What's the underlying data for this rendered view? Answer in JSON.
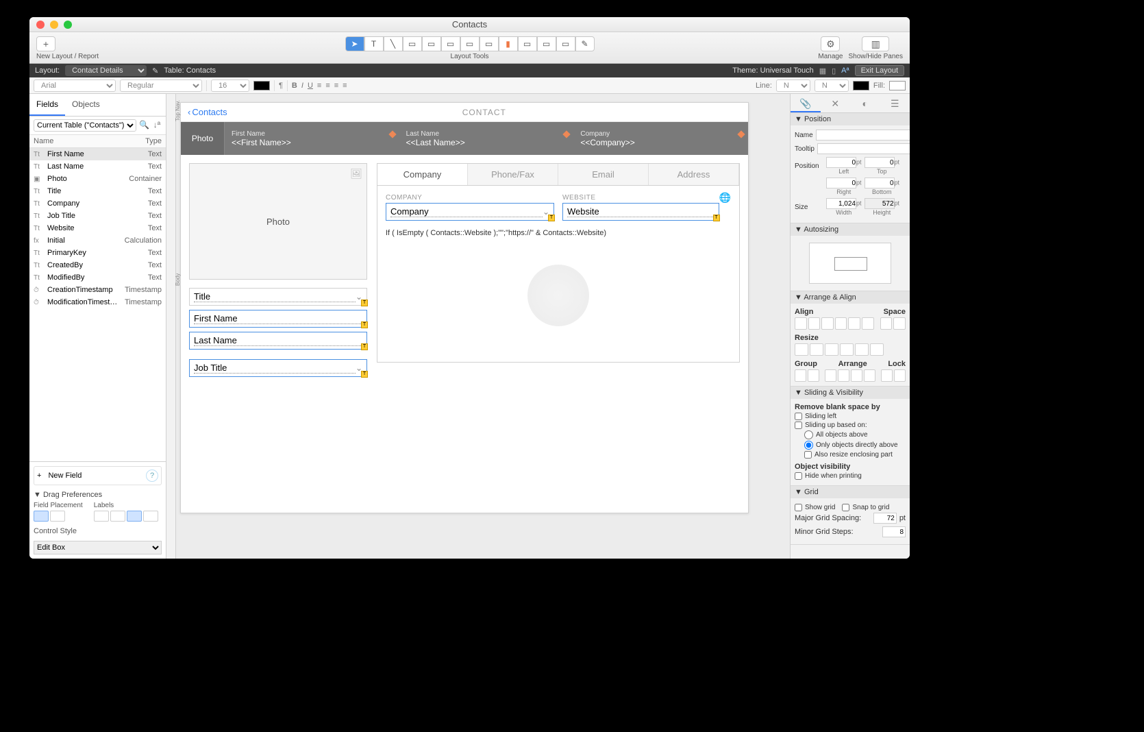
{
  "window": {
    "title": "Contacts"
  },
  "toolbar": {
    "newLayout": "New Layout / Report",
    "layoutTools": "Layout Tools",
    "manage": "Manage",
    "showHide": "Show/Hide Panes"
  },
  "statusbar": {
    "layoutLabel": "Layout:",
    "layoutName": "Contact Details",
    "tableLabel": "Table: Contacts",
    "themeLabel": "Theme: Universal Touch",
    "exit": "Exit Layout"
  },
  "formatbar": {
    "font": "Arial",
    "weight": "Regular",
    "size": "16 pt",
    "lineLabel": "Line:",
    "lineStyle": "None",
    "lineWidth": "None",
    "fillLabel": "Fill:"
  },
  "leftPanel": {
    "tabFields": "Fields",
    "tabObjects": "Objects",
    "currentTable": "Current Table (\"Contacts\")",
    "colName": "Name",
    "colType": "Type",
    "fields": [
      {
        "icon": "Tt",
        "name": "First Name",
        "type": "Text",
        "sel": true
      },
      {
        "icon": "Tt",
        "name": "Last Name",
        "type": "Text"
      },
      {
        "icon": "▣",
        "name": "Photo",
        "type": "Container"
      },
      {
        "icon": "Tt",
        "name": "Title",
        "type": "Text"
      },
      {
        "icon": "Tt",
        "name": "Company",
        "type": "Text"
      },
      {
        "icon": "Tt",
        "name": "Job Title",
        "type": "Text"
      },
      {
        "icon": "Tt",
        "name": "Website",
        "type": "Text"
      },
      {
        "icon": "fx",
        "name": "Initial",
        "type": "Calculation"
      },
      {
        "icon": "Tt",
        "name": "PrimaryKey",
        "type": "Text"
      },
      {
        "icon": "Tt",
        "name": "CreatedBy",
        "type": "Text"
      },
      {
        "icon": "Tt",
        "name": "ModifiedBy",
        "type": "Text"
      },
      {
        "icon": "⏱",
        "name": "CreationTimestamp",
        "type": "Timestamp"
      },
      {
        "icon": "⏱",
        "name": "ModificationTimesta…",
        "type": "Timestamp"
      }
    ],
    "newField": "New Field",
    "dragPrefs": "Drag Preferences",
    "fieldPlacement": "Field Placement",
    "labels": "Labels",
    "controlStyle": "Control Style",
    "controlValue": "Edit Box"
  },
  "canvas": {
    "partTop": "Top Nav.",
    "partBody": "Body",
    "back": "Contacts",
    "pageTitle": "CONTACT",
    "photoCell": "Photo",
    "h1l": "First Name",
    "h1m": "<<First Name>>",
    "h2l": "Last Name",
    "h2m": "<<Last Name>>",
    "h3l": "Company",
    "h3m": "<<Company>>",
    "photoBox": "Photo",
    "fTitle": "Title",
    "fFirst": "First Name",
    "fLast": "Last Name",
    "fJob": "Job Title",
    "tabs": [
      "Company",
      "Phone/Fax",
      "Email",
      "Address"
    ],
    "lblCompany": "COMPANY",
    "lblWebsite": "WEBSITE",
    "fCompany": "Company",
    "fWebsite": "Website",
    "calc": "If ( IsEmpty ( Contacts::Website );\"\";\"https://\" & Contacts::Website)"
  },
  "inspector": {
    "secPosition": "Position",
    "name": "Name",
    "tooltip": "Tooltip",
    "position": "Position",
    "left": "Left",
    "top": "Top",
    "right": "Right",
    "bottom": "Bottom",
    "posLeft": "0",
    "posTop": "0",
    "posRight": "0",
    "posBottom": "0",
    "size": "Size",
    "width": "Width",
    "height": "Height",
    "widthVal": "1,024",
    "heightVal": "572",
    "unit": "pt",
    "secAutosize": "Autosizing",
    "secArrange": "Arrange & Align",
    "align": "Align",
    "space": "Space",
    "resize": "Resize",
    "group": "Group",
    "arrange": "Arrange",
    "lock": "Lock",
    "secSliding": "Sliding & Visibility",
    "removeBlank": "Remove blank space by",
    "slideLeft": "Sliding left",
    "slideUp": "Sliding up based on:",
    "allAbove": "All objects above",
    "onlyAbove": "Only objects directly above",
    "alsoResize": "Also resize enclosing part",
    "objVis": "Object visibility",
    "hidePrint": "Hide when printing",
    "secGrid": "Grid",
    "showGrid": "Show grid",
    "snapGrid": "Snap to grid",
    "majorGrid": "Major Grid Spacing:",
    "majorVal": "72",
    "minorGrid": "Minor Grid Steps:",
    "minorVal": "8"
  }
}
